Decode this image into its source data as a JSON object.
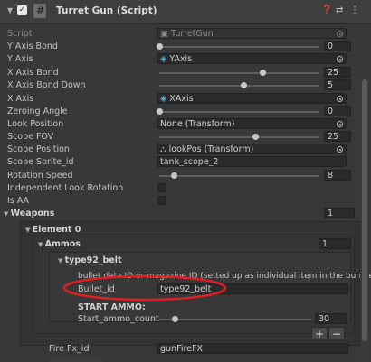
{
  "header": {
    "title": "Turret Gun (Script)"
  },
  "script_row": {
    "label": "Script",
    "value": "TurretGun"
  },
  "rows": {
    "y_axis_bond": {
      "label": "Y Axis Bond",
      "value": "0",
      "fraction": 0
    },
    "y_axis": {
      "label": "Y Axis",
      "value": "YAxis"
    },
    "x_axis_bond": {
      "label": "X Axis Bond",
      "value": "25",
      "fraction": 0.65
    },
    "x_axis_bond_down": {
      "label": "X Axis Bond Down",
      "value": "5",
      "fraction": 0.53
    },
    "x_axis": {
      "label": "X Axis",
      "value": "XAxis"
    },
    "zeroing_angle": {
      "label": "Zeroing Angle",
      "value": "0",
      "fraction": 0
    },
    "look_position": {
      "label": "Look Position",
      "value": "None (Transform)"
    },
    "scope_fov": {
      "label": "Scope FOV",
      "value": "25",
      "fraction": 0.6
    },
    "scope_position": {
      "label": "Scope Position",
      "value": "lookPos (Transform)"
    },
    "scope_sprite_id": {
      "label": "Scope Sprite_id",
      "value": "tank_scope_2"
    },
    "rotation_speed": {
      "label": "Rotation Speed",
      "value": "8",
      "fraction": 0.09
    },
    "independent_look_rotation": {
      "label": "Independent Look Rotation"
    },
    "is_aa": {
      "label": "Is AA"
    }
  },
  "weapons": {
    "label": "Weapons",
    "count": "1",
    "element0": {
      "label": "Element 0",
      "ammos": {
        "label": "Ammos",
        "count": "1",
        "item": {
          "label": "type92_belt",
          "note": "bullet data ID or magazine ID (setted up as individual item in the bundle",
          "bullet_id_label": "Bullet_id",
          "bullet_id_value": "type92_belt",
          "start_ammo_header": "START AMMO:",
          "start_ammo_label": "Start_ammo_count",
          "start_ammo_value": "30",
          "start_ammo_fraction": 0.1
        }
      },
      "fire_fx": {
        "label": "Fire Fx_id",
        "value": "gunFireFX"
      }
    }
  },
  "buttons": {
    "plus": "+",
    "minus": "−"
  },
  "icons": [
    "foldout-arrow-icon",
    "checkbox-icon",
    "script-icon",
    "help-icon",
    "preset-icon",
    "menu-icon",
    "object-picker-icon",
    "transform-icon",
    "plus-icon",
    "minus-icon"
  ],
  "colors": {
    "background": "#383838",
    "field": "#2a2a2a",
    "highlight": "#e31e24"
  }
}
